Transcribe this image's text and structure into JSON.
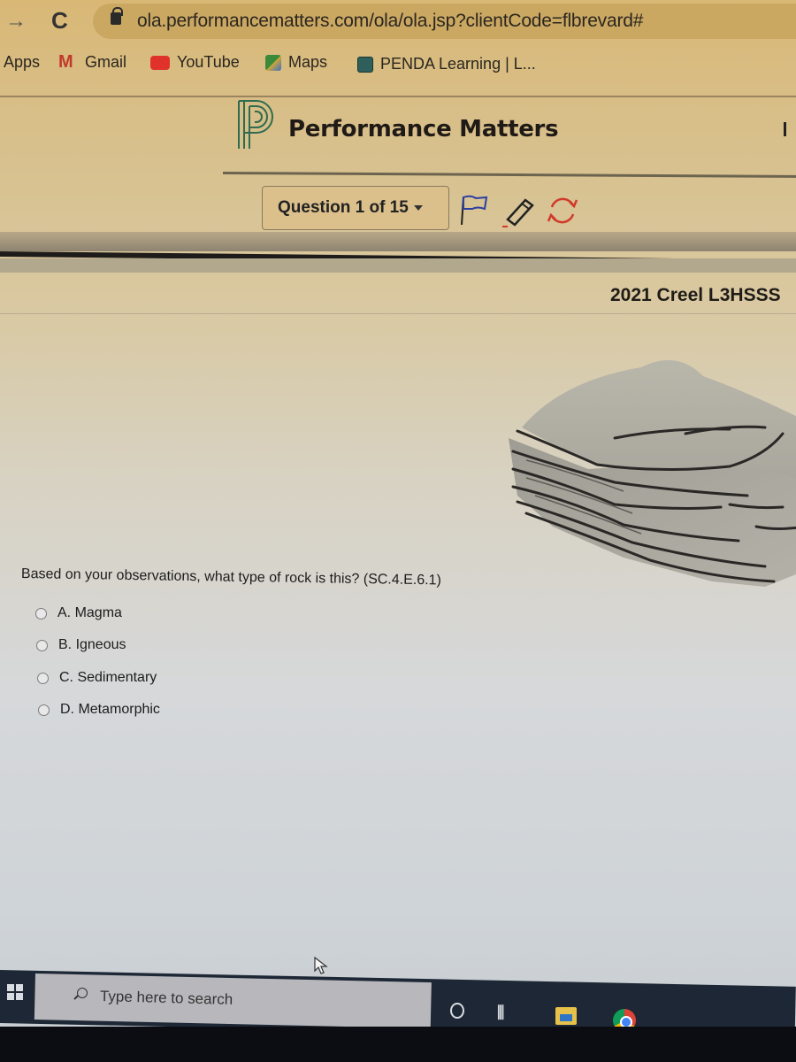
{
  "browser": {
    "url": "ola.performancematters.com/ola/ola.jsp?clientCode=flbrevard#",
    "bookmarks": [
      {
        "label": "Apps",
        "icon": "apps-icon"
      },
      {
        "label": "Gmail",
        "icon": "gmail-icon"
      },
      {
        "label": "YouTube",
        "icon": "youtube-icon"
      },
      {
        "label": "Maps",
        "icon": "maps-icon"
      },
      {
        "label": "PENDA Learning | L...",
        "icon": "penda-icon"
      }
    ]
  },
  "header": {
    "brand": "Performance Matters"
  },
  "toolbar": {
    "question_selector": "Question 1 of 15",
    "icons": [
      "flag-icon",
      "pencil-icon",
      "refresh-icon"
    ],
    "colors": {
      "flag": "#2b3fa0",
      "pencil": "#222222",
      "refresh": "#d03a2a"
    }
  },
  "test": {
    "title": "2021 Creel L3HSSS"
  },
  "question": {
    "image": "layered-sedimentary-rock",
    "text": "Based on your observations, what type of rock is this? (SC.4.E.6.1)",
    "options": [
      {
        "label": "A. Magma",
        "selected": false
      },
      {
        "label": "B. Igneous",
        "selected": false
      },
      {
        "label": "C. Sedimentary",
        "selected": false
      },
      {
        "label": "D. Metamorphic",
        "selected": false
      }
    ]
  },
  "taskbar": {
    "search_placeholder": "Type here to search",
    "apps": [
      "cortana-icon",
      "task-view-icon",
      "file-explorer-icon",
      "chrome-icon"
    ]
  }
}
